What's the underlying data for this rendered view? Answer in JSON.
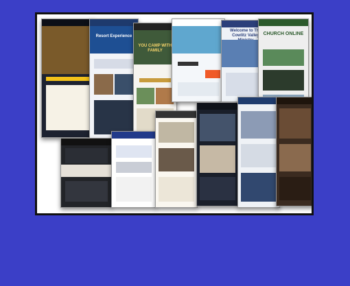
{
  "thumbnails": [
    {
      "id": "s1",
      "bg": "#1d2230",
      "bar": "#0c0f17",
      "hero": "#7a5a2a",
      "text": ""
    },
    {
      "id": "s2",
      "bg": "#f2f4f8",
      "bar": "#1e3a6d",
      "hero": "#1e4f93",
      "text": "Resort Experience"
    },
    {
      "id": "s3",
      "bg": "#f6f4ef",
      "bar": "#222",
      "hero": "#3f5a3a",
      "text": "YOU CAMP WITH FAMILY"
    },
    {
      "id": "s4",
      "bg": "#f4f7fa",
      "bar": "#ffffff",
      "hero": "#5fa7cf",
      "text": ""
    },
    {
      "id": "s5",
      "bg": "#eef2f7",
      "bar": "#2b3f7a",
      "hero": "#5a7fb3",
      "text": "Welcome to The Cowlitz Valley Ministry"
    },
    {
      "id": "s6",
      "bg": "#eeeeee",
      "bar": "#2c5a2c",
      "hero": "#4a7a4a",
      "text": "CHURCH ONLINE"
    },
    {
      "id": "s7",
      "bg": "#222428",
      "bar": "#111",
      "hero": "#2b2e35",
      "text": ""
    },
    {
      "id": "s8",
      "bg": "#ffffff",
      "bar": "#213a8a",
      "hero": "#dfe5f2",
      "text": ""
    },
    {
      "id": "s9",
      "bg": "#faf7f0",
      "bar": "#333",
      "hero": "#c0b7a3",
      "text": ""
    },
    {
      "id": "s10",
      "bg": "#1a1f2a",
      "bar": "#0f1219",
      "hero": "#44536b",
      "text": ""
    },
    {
      "id": "s11",
      "bg": "#eff2f6",
      "bar": "#1f3c6e",
      "hero": "#8c9bb5",
      "text": ""
    },
    {
      "id": "s12",
      "bg": "#3b2b20",
      "bar": "#1e140c",
      "hero": "#6a4c35",
      "text": ""
    }
  ],
  "colors": {
    "background": "#3b3fc7",
    "frame_border": "#111111",
    "frame_fill": "#ffffff"
  }
}
